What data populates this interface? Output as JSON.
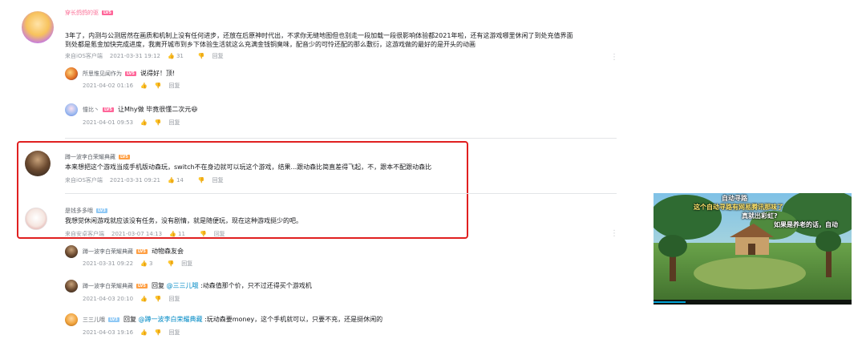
{
  "comments": [
    {
      "user": "穿长鸽鸽的驱",
      "level": "LV5",
      "content_line1": "3年了，内测与公测居然在画质和机制上没有任何进步，还放在后原神时代出，不求你无缝地图但也别走一段加载一段很影响体验都2021年啦，还有这游戏哪里休闲了到处充值界面",
      "content_line2": "到处都是氪金加快完成进度，我离开城市到乡下体验生活就这么充满金钱铜臭味，配音少的可怜还配的那么敷衍，这游戏做的最好的是开头的动画",
      "source": "来自iOS客户端",
      "time": "2021-03-31 19:12",
      "likes": "31",
      "reply_label": "回复",
      "more": "⋮",
      "replies": [
        {
          "user": "所思惟见闻作为",
          "level": "LV5",
          "text": "说得好！顶!",
          "time": "2021-04-02 01:16",
          "reply_label": "回复"
        },
        {
          "user": "憧比丶",
          "level": "LV5",
          "text": "让Mhy做 毕竟很懂二次元",
          "emoji": "😆",
          "time": "2021-04-01 09:53",
          "reply_label": "回复"
        }
      ]
    },
    {
      "user": "蹲一波李白荣耀典藏",
      "level": "LV5",
      "content": "本来想把这个游戏当成手机版动森玩，switch不在身边就可以玩这个游戏，结果...跟动森比简直差得飞起，不，跟本不配跟动森比",
      "source": "来自iOS客户端",
      "time": "2021-03-31 09:21",
      "likes": "14",
      "reply_label": "回复"
    },
    {
      "user": "是钱多多哦",
      "level": "LV3",
      "content": "我想觉休闲游戏就应该没有任务，没有剧情，就是随便玩，现在这种游戏挺少的吧。",
      "source": "来自安卓客户端",
      "time": "2021-03-07 14:13",
      "likes": "11",
      "reply_label": "回复",
      "more": "⋮",
      "replies": [
        {
          "user": "蹲一波李白荣耀典藏",
          "level": "LV5",
          "text": "动物森友会",
          "time": "2021-03-31 09:22",
          "likes": "3",
          "reply_label": "回复"
        },
        {
          "user": "蹲一波李白荣耀典藏",
          "level": "LV5",
          "text_prefix": "回复 ",
          "mention": "@三三儿哦",
          "text": " :动森值那个价，只不过还得买个游戏机",
          "time": "2021-04-03 20:10",
          "reply_label": "回复"
        },
        {
          "user": "三三儿哦",
          "level": "LV3",
          "text_prefix": "回复 ",
          "mention": "@蹲一波李白荣耀典藏",
          "text": " :玩动森要money，这个手机就可以，只要不充，还是挺休闲的",
          "time": "2021-04-03 19:16",
          "reply_label": "回复"
        }
      ]
    }
  ],
  "video": {
    "title": "自动寻路",
    "subtitle1": "这个自动寻路有网易腾讯那味了",
    "subtitle2": "真就出彩虹?",
    "subtitle3": "如果是养老的话，自动"
  }
}
